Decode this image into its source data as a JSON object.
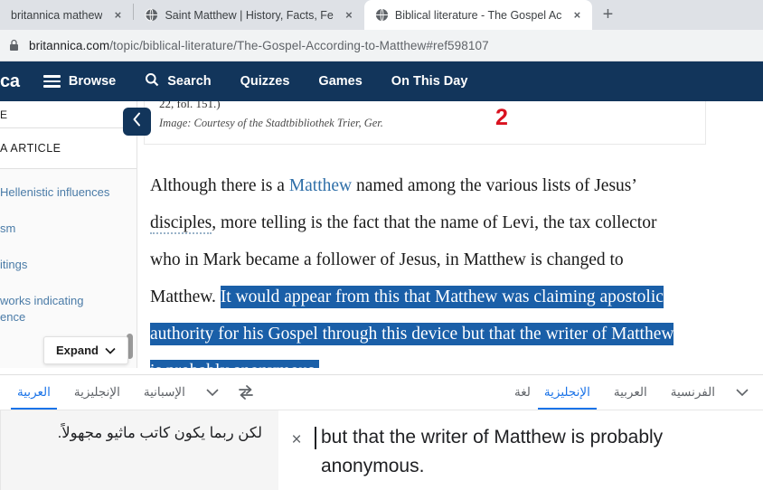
{
  "browser": {
    "tabs": [
      {
        "title": "britannica mathew",
        "active": false,
        "favicon": "globe-icon",
        "close": "×"
      },
      {
        "title": "Saint Matthew | History, Facts, Fe",
        "active": false,
        "favicon": "globe-icon",
        "close": "×"
      },
      {
        "title": "Biblical literature - The Gospel Ac",
        "active": true,
        "favicon": "globe-icon",
        "close": "×"
      }
    ],
    "new_tab_label": "+",
    "omnibox": {
      "lock_icon": "lock-icon",
      "url_domain": "britannica.com",
      "url_path": "/topic/biblical-literature/The-Gospel-According-to-Matthew#ref598107"
    }
  },
  "site_nav": {
    "brand": "ca",
    "items": [
      {
        "label": "Browse",
        "icon": "hamburger-icon"
      },
      {
        "label": "Search",
        "icon": "search-icon"
      },
      {
        "label": "Quizzes",
        "icon": ""
      },
      {
        "label": "Games",
        "icon": ""
      },
      {
        "label": "On This Day",
        "icon": ""
      }
    ],
    "bg_color": "#12355b"
  },
  "sidebar": {
    "header": "E",
    "subheader": "A ARTICLE",
    "links": [
      "Hellenistic influences",
      "sm",
      "itings",
      "works indicating\nence"
    ],
    "expand_label": "Expand",
    "expand_chevron": "⌄",
    "collapse_icon": "chevron-left-icon"
  },
  "article": {
    "figure_ref": "22, fol. 151.)",
    "figure_credit": "Image: Courtesy of the Stadtbibliothek Trier, Ger.",
    "annotation_number": "2",
    "annotation_color": "#d9121f",
    "paragraph": {
      "seg1": "Although there is a ",
      "link_matthew": "Matthew",
      "seg2": " named among the various lists of Jesus’ ",
      "link_disciples": "disciples",
      "seg3": ", more telling is the fact that the name of Levi, the tax collector who in Mark became a follower of Jesus, in Matthew is changed to Matthew. ",
      "highlighted": "It would appear from this that Matthew was claiming apostolic authority for his Gospel through this device but that the writer of Matthew is probably anonymous."
    },
    "highlight_color": "#1a5fa8",
    "link_color": "#2f6fa8"
  },
  "translate": {
    "source": {
      "tabs": [
        {
          "label": "الإنجليزية",
          "active": true
        },
        {
          "label": "العربية",
          "active": false
        },
        {
          "label": "الفرنسية",
          "active": false
        }
      ],
      "leading_label": "لغة",
      "more_icon": "chevron-down-icon",
      "text": "but that the writer of Matthew is probably anonymous.",
      "clear_icon": "×"
    },
    "swap_icon": "swap-arrows-icon",
    "target": {
      "tabs": [
        {
          "label": "العربية",
          "active": true
        },
        {
          "label": "الإنجليزية",
          "active": false
        },
        {
          "label": "الإسبانية",
          "active": false
        }
      ],
      "more_icon": "chevron-down-icon",
      "text": "لكن ربما يكون كاتب ماثيو مجهولاً."
    },
    "accent_color": "#1a73e8"
  }
}
